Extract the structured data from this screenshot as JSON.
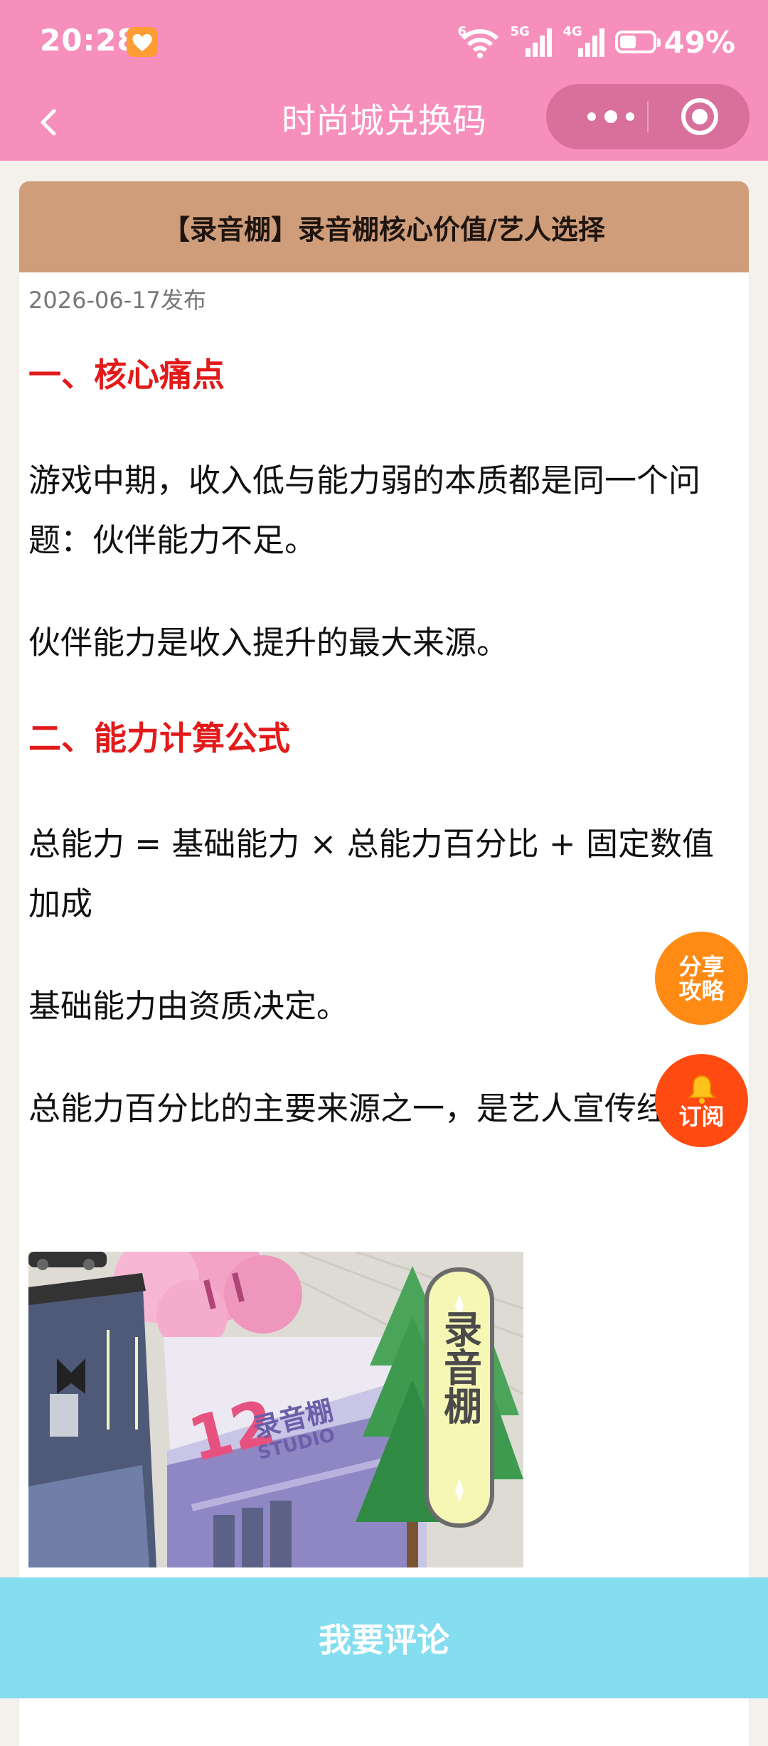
{
  "status_bar": {
    "time": "20:28",
    "wifi_tag": "6",
    "sig1_tag": "5G",
    "sig2_tag": "4G",
    "battery_percent": "49%",
    "battery_level": 0.49
  },
  "header": {
    "title": "时尚城兑换码",
    "bg_color": "#f78fbc"
  },
  "article": {
    "title": "【录音棚】录音棚核心价值/艺人选择",
    "date": "2026-06-17发布",
    "heading1": "一、核心痛点",
    "para1": "游戏中期，收入低与能力弱的本质都是同一个问题：伙伴能力不足。",
    "para2": "伙伴能力是收入提升的最大来源。",
    "heading2": "二、能力计算公式",
    "para3": "总能力 = 基础能力 × 总能力百分比 + 固定数值加成",
    "para4": "基础能力由资质决定。",
    "para5": "总能力百分比的主要来源之一，是艺人宣传经验。",
    "image": {
      "sign_text": "录音棚",
      "building_number": "12",
      "building_name": "录音棚",
      "building_sub": "STUDIO"
    }
  },
  "floating": {
    "share_line1": "分享",
    "share_line2": "攻略",
    "subscribe_icon": "bell-icon",
    "subscribe_label": "订阅"
  },
  "footer": {
    "comment_label": "我要评论",
    "bg_color": "#85ddf0"
  }
}
